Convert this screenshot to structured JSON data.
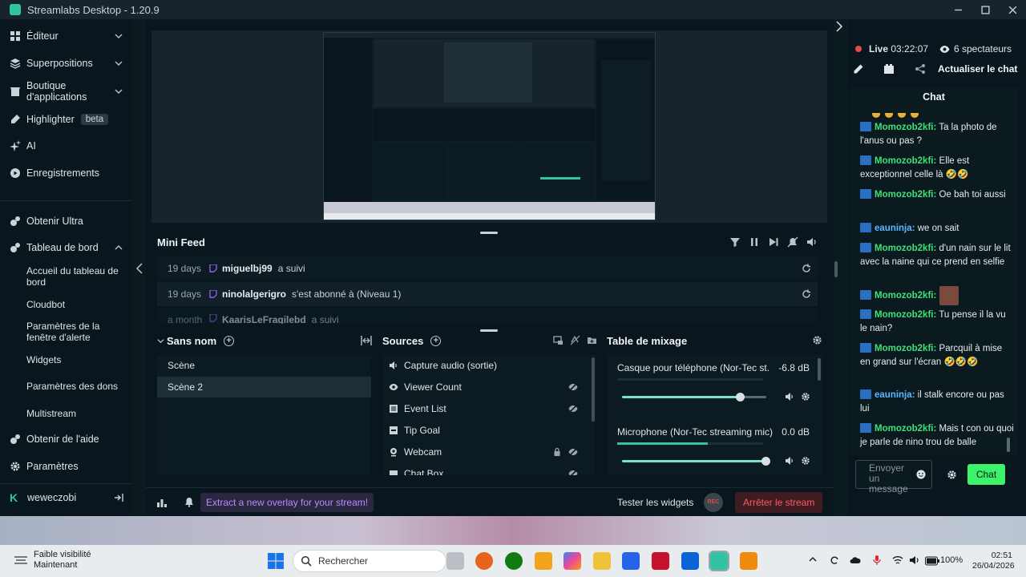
{
  "window": {
    "title": "Streamlabs Desktop - 1.20.9"
  },
  "sidebar": {
    "items": [
      {
        "label": "Éditeur",
        "icon": "grid-icon"
      },
      {
        "label": "Superpositions",
        "icon": "layers-icon"
      },
      {
        "label": "Boutique d'applications",
        "icon": "store-icon"
      },
      {
        "label": "Highlighter",
        "icon": "highlighter-icon",
        "badge": "beta"
      },
      {
        "label": "AI",
        "icon": "sparkles-icon"
      },
      {
        "label": "Enregistrements",
        "icon": "play-circle-icon"
      },
      {
        "label": "Obtenir Ultra",
        "icon": "ultra-icon"
      },
      {
        "label": "Tableau de bord",
        "icon": "dashboard-icon"
      }
    ],
    "dashboard_sub": [
      "Accueil du tableau de bord",
      "Cloudbot",
      "Paramètres de la fenêtre d'alerte",
      "Widgets",
      "Paramètres des dons",
      "Multistream"
    ],
    "help": "Obtenir de l'aide",
    "settings": "Paramètres",
    "user": "weweczobi"
  },
  "minifeed": {
    "title": "Mini Feed",
    "rows": [
      {
        "age": "19 days",
        "user": "miguelbj99",
        "action": "a suivi"
      },
      {
        "age": "19 days",
        "user": "ninolalgerigro",
        "action": "s'est abonné à (Niveau 1)"
      },
      {
        "age": "a month",
        "user": "KaarisLeFragilebd",
        "action": "a suivi"
      }
    ]
  },
  "scenes": {
    "title": "Sans nom",
    "items": [
      "Scène",
      "Scène 2"
    ],
    "selected": "Scène 2"
  },
  "sources": {
    "title": "Sources",
    "items": [
      {
        "label": "Capture audio (sortie)",
        "icon": "speaker-icon"
      },
      {
        "label": "Viewer Count",
        "icon": "eye-icon"
      },
      {
        "label": "Event List",
        "icon": "list-icon"
      },
      {
        "label": "Tip Goal",
        "icon": "goal-icon"
      },
      {
        "label": "Webcam",
        "icon": "webcam-icon"
      },
      {
        "label": "Chat Box",
        "icon": "chat-icon"
      }
    ]
  },
  "mixer": {
    "title": "Table de mixage",
    "channels": [
      {
        "name": "Casque pour téléphone (Nor-Tec st...",
        "db": "-6.8 dB",
        "volume": 0.82,
        "meter": 0
      },
      {
        "name": "Microphone (Nor-Tec streaming mic)",
        "db": "0.0 dB",
        "volume": 1.0,
        "meter": 0.62
      }
    ]
  },
  "footer": {
    "promo": "Extract a new overlay for your stream!",
    "test_widgets": "Tester les widgets",
    "rec": "REC",
    "stop_stream": "Arrêter le stream"
  },
  "chat": {
    "live_label": "Live",
    "live_time": "03:22:07",
    "viewers": "6 spectateurs",
    "refresh": "Actualiser le chat",
    "title": "Chat",
    "messages": [
      {
        "user": "Momozob2kfi",
        "text": "Ta la photo de l'anus ou pas ?"
      },
      {
        "user": "Momozob2kfi",
        "text": "Elle est exceptionnel celle là 🤣🤣"
      },
      {
        "user": "Momozob2kfi",
        "text": "Oe bah toi aussi"
      },
      {
        "user": "eauninja",
        "text": "we on sait"
      },
      {
        "user": "Momozob2kfi",
        "text": "d'un nain sur le lit avec la naine qui ce prend en selfie"
      },
      {
        "user": "Momozob2kfi",
        "text": ""
      },
      {
        "user": "Momozob2kfi",
        "text": "Tu pense il la vu le nain?"
      },
      {
        "user": "Momozob2kfi",
        "text": "Parcquil à mise en grand sur l'écran 🤣🤣🤣"
      },
      {
        "user": "eauninja",
        "text": "il stalk encore ou pas lui"
      },
      {
        "user": "Momozob2kfi",
        "text": "Mais t con ou quoi je parle de nino trou de balle"
      }
    ],
    "input_placeholder": "Envoyer un message",
    "send": "Chat"
  },
  "taskbar": {
    "weather_title": "Faible visibilité",
    "weather_sub": "Maintenant",
    "search": "Rechercher",
    "battery": "100%",
    "time": "02:51",
    "date": "26/04/2026"
  },
  "colors": {
    "accent": "#31c3a2",
    "chat_send": "#3bf26a",
    "live_red": "#e4484a",
    "chat_user_green": "#3ee07a",
    "chat_user_blue": "#5fb6ff",
    "promo": "#b48cff"
  }
}
